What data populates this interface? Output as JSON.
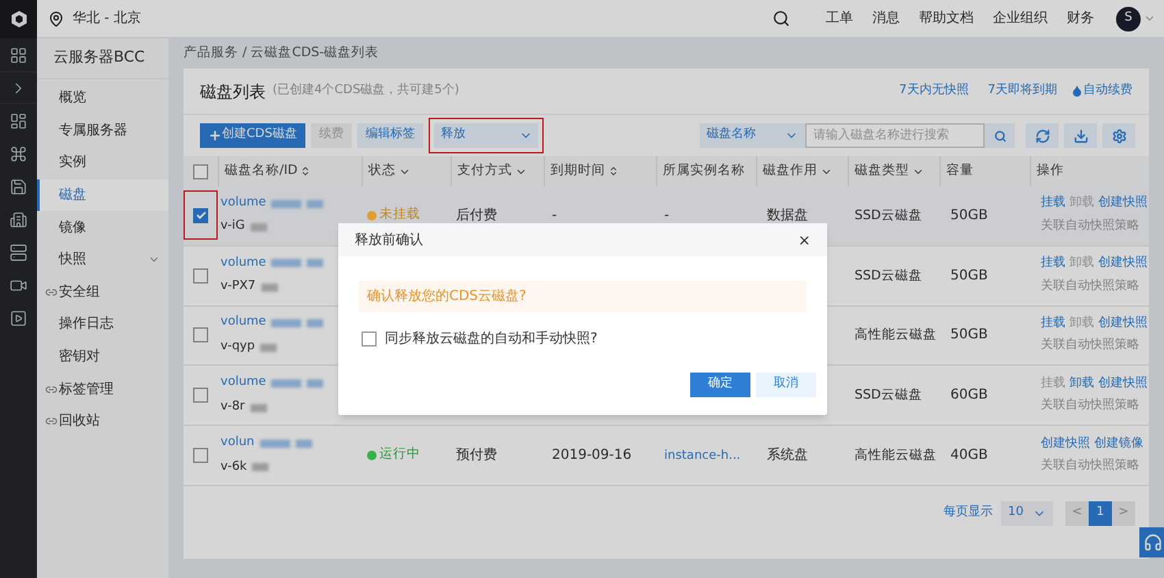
{
  "topbar": {
    "region": "华北 - 北京",
    "links": [
      "工单",
      "消息",
      "帮助文档",
      "企业组织",
      "财务"
    ],
    "avatar": "S"
  },
  "sidebar": {
    "title": "云服务器BCC",
    "items": [
      {
        "label": "概览",
        "selected": false,
        "kind": "plain"
      },
      {
        "label": "专属服务器",
        "selected": false,
        "kind": "plain"
      },
      {
        "label": "实例",
        "selected": false,
        "kind": "plain"
      },
      {
        "label": "磁盘",
        "selected": true,
        "kind": "plain"
      },
      {
        "label": "镜像",
        "selected": false,
        "kind": "plain"
      },
      {
        "label": "快照",
        "selected": false,
        "kind": "group"
      },
      {
        "label": "安全组",
        "selected": false,
        "kind": "link"
      },
      {
        "label": "操作日志",
        "selected": false,
        "kind": "plain"
      },
      {
        "label": "密钥对",
        "selected": false,
        "kind": "plain"
      },
      {
        "label": "标签管理",
        "selected": false,
        "kind": "link"
      },
      {
        "label": "回收站",
        "selected": false,
        "kind": "link"
      }
    ]
  },
  "breadcrumb": [
    "产品服务",
    "/",
    "云磁盘CDS-磁盘列表"
  ],
  "card": {
    "title": "磁盘列表",
    "subtitle": "(已创建4个CDS磁盘，共可建5个)",
    "links": [
      "7天内无快照",
      "7天即将到期"
    ],
    "auto_renew": "自动续费"
  },
  "toolbar": {
    "buttons": [
      {
        "label": "创建CDS磁盘",
        "kind": "primary"
      },
      {
        "label": "续费",
        "kind": "disabled"
      },
      {
        "label": "编辑标签",
        "kind": "secondary"
      }
    ],
    "release": {
      "label": "释放",
      "highlighted": true
    },
    "search_select": "磁盘名称",
    "search": {
      "placeholder": "请输入磁盘名称进行搜索"
    }
  },
  "table": {
    "select_all": {
      "checked": false
    },
    "columns": [
      {
        "label": "磁盘名称/ID",
        "kind": "sort"
      },
      {
        "label": "状态",
        "kind": "filter"
      },
      {
        "label": "支付方式",
        "kind": "filter"
      },
      {
        "label": "到期时间",
        "kind": "sort"
      },
      {
        "label": "所属实例名称",
        "kind": "plain"
      },
      {
        "label": "磁盘作用",
        "kind": "filter"
      },
      {
        "label": "磁盘类型",
        "kind": "filter"
      },
      {
        "label": "容量",
        "kind": "plain"
      },
      {
        "label": "操作",
        "kind": "plain"
      }
    ],
    "rows": [
      {
        "checked": true,
        "highlighted": true,
        "name": "volume",
        "id": "v-iG",
        "status": "未挂载",
        "color": "#e0a030",
        "pay": "后付费",
        "due": "-",
        "instance": "-",
        "role": "数据盘",
        "type": "SSD云磁盘",
        "size": "50GB",
        "actions": [
          {
            "label": "挂载",
            "disabled": false
          },
          {
            "label": "卸载",
            "disabled": true
          },
          {
            "label": "创建快照",
            "disabled": false
          }
        ],
        "policy": "关联自动快照策略"
      },
      {
        "checked": false,
        "highlighted": false,
        "name": "volume",
        "id": "v-PX7",
        "type": "SSD云磁盘",
        "size": "50GB",
        "actions": [
          {
            "label": "挂载",
            "disabled": false
          },
          {
            "label": "卸载",
            "disabled": true
          },
          {
            "label": "创建快照",
            "disabled": false
          }
        ],
        "policy": "关联自动快照策略"
      },
      {
        "checked": false,
        "highlighted": false,
        "name": "volume",
        "id": "v-qyp",
        "type": "高性能云磁盘",
        "size": "50GB",
        "actions": [
          {
            "label": "挂载",
            "disabled": false
          },
          {
            "label": "卸载",
            "disabled": true
          },
          {
            "label": "创建快照",
            "disabled": false
          }
        ],
        "policy": "关联自动快照策略"
      },
      {
        "checked": false,
        "highlighted": false,
        "name": "volume",
        "id": "v-8r",
        "type": "SSD云磁盘",
        "size": "60GB",
        "actions": [
          {
            "label": "挂载",
            "disabled": true
          },
          {
            "label": "卸载",
            "disabled": false
          },
          {
            "label": "创建快照",
            "disabled": false
          }
        ],
        "policy": "关联自动快照策略"
      },
      {
        "checked": false,
        "highlighted": false,
        "name": "volun",
        "id": "v-6k",
        "status": "运行中",
        "color": "#3ab04a",
        "pay": "预付费",
        "due": "2019-09-16",
        "instance": "instance-h...",
        "role": "系统盘",
        "type": "高性能云磁盘",
        "size": "40GB",
        "actions": [
          {
            "label": "创建快照",
            "disabled": false
          },
          {
            "label": "创建镜像",
            "disabled": false
          }
        ],
        "policy": "关联自动快照策略"
      }
    ]
  },
  "pagination": {
    "label": "每页显示",
    "page_size": "10",
    "prev": "<",
    "pages": [
      {
        "label": "1",
        "selected": true
      }
    ],
    "next": ">"
  },
  "dialog": {
    "title": "释放前确认",
    "close": "×",
    "warning": "确认释放您的CDS云磁盘?",
    "option": {
      "label": "同步释放云磁盘的自动和手动快照?",
      "checked": false
    },
    "buttons": [
      {
        "label": "确定",
        "kind": "primary"
      },
      {
        "label": "取消",
        "kind": "secondary"
      }
    ]
  }
}
